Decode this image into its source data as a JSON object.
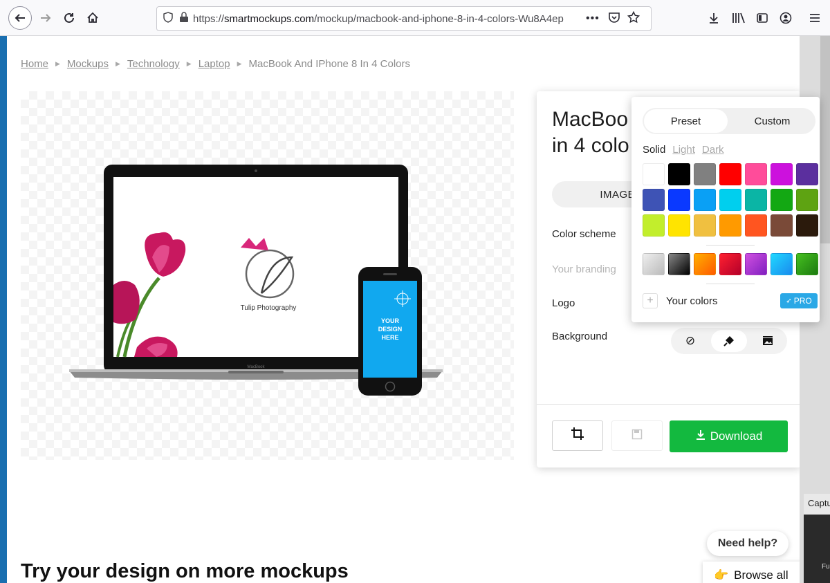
{
  "browser": {
    "url_prefix": "https://",
    "url_host": "smartmockups.com",
    "url_path": "/mockup/macbook-and-iphone-8-in-4-colors-Wu8A4ep"
  },
  "breadcrumb": {
    "items": [
      "Home",
      "Mockups",
      "Technology",
      "Laptop"
    ],
    "current": "MacBook And IPhone 8 In 4 Colors"
  },
  "preview": {
    "logo_text": "Tulip Photography",
    "laptop_brand": "MacBook",
    "phone_text_1": "YOUR",
    "phone_text_2": "DESIGN",
    "phone_text_3": "HERE"
  },
  "panel": {
    "title": "MacBoo\nin 4 colo",
    "images_tab": "IMAGES",
    "color_scheme_label": "Color scheme",
    "branding_label": "Your branding",
    "logo_label": "Logo",
    "background_label": "Background",
    "download_label": "Download"
  },
  "color_popup": {
    "tabs": [
      "Preset",
      "Custom"
    ],
    "active_tab": "Preset",
    "tints": [
      "Solid",
      "Light",
      "Dark"
    ],
    "swatches": [
      "#ffffff",
      "#000000",
      "#808080",
      "#ff0000",
      "#ff4c9a",
      "#cc11dd",
      "#5b2f9e",
      "#3e53b5",
      "#0a39ff",
      "#0aa0f5",
      "#00cfee",
      "#0bb5a5",
      "#13a813",
      "#5ea312",
      "#c2ee2c",
      "#ffe400",
      "#f0c040",
      "#ff9a00",
      "#ff5520",
      "#7a4a38",
      "#2b1a0c"
    ],
    "gradients": [
      [
        "#eeeeee",
        "#bbbbbb"
      ],
      [
        "#888888",
        "#000000"
      ],
      [
        "#ffb000",
        "#ff5a00"
      ],
      [
        "#ff2030",
        "#b3002a"
      ],
      [
        "#d050e0",
        "#8020c0"
      ],
      [
        "#20d8ff",
        "#1a8aee"
      ],
      [
        "#46c020",
        "#1c7a10"
      ]
    ],
    "your_colors_label": "Your colors",
    "pro_label": "PRO"
  },
  "footer": {
    "section_heading": "Try your design on more mockups",
    "help_label": "Need help?",
    "browse_label": "Browse all"
  },
  "capture_widget": {
    "title": "Captu",
    "label": "Fu"
  }
}
